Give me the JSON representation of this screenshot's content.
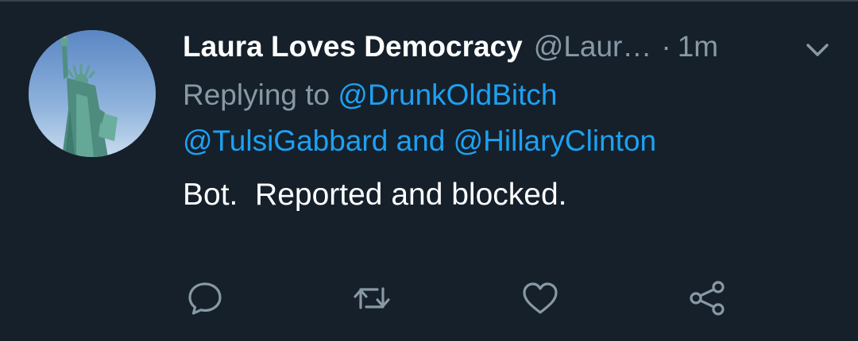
{
  "tweet": {
    "display_name": "Laura Loves Democracy",
    "handle": "@Laur…",
    "separator": "·",
    "timestamp": "1m",
    "replying_prefix": "Replying to",
    "mentions": [
      "@DrunkOldBitch",
      "@TulsiGabbard",
      "@HillaryClinton"
    ],
    "mention_joiner": "and",
    "text": "Bot.  Reported and blocked."
  },
  "actions": [
    "reply-icon",
    "retweet-icon",
    "like-icon",
    "share-icon"
  ],
  "colors": {
    "background": "#15202b",
    "primary_text": "#ffffff",
    "secondary_text": "#8899a6",
    "link": "#1da1f2",
    "divider": "#38444d"
  }
}
